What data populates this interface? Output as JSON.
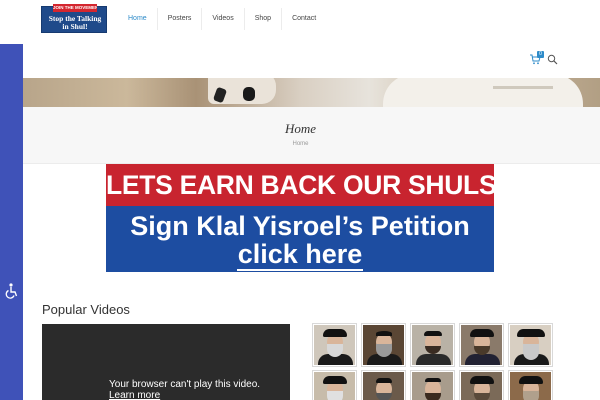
{
  "logo": {
    "banner": "JOIN THE MOVEMENT!",
    "line1": "Stop the Talking",
    "line2": "in Shul!"
  },
  "nav": {
    "items": [
      {
        "label": "Home",
        "active": true
      },
      {
        "label": "Posters",
        "active": false
      },
      {
        "label": "Videos",
        "active": false
      },
      {
        "label": "Shop",
        "active": false
      },
      {
        "label": "Contact",
        "active": false
      }
    ]
  },
  "cart": {
    "count": "0"
  },
  "colors": {
    "accent": "#2e8bc9",
    "a11y_bar": "#3f52b8",
    "petition_red": "#c8242f",
    "petition_blue": "#1d4da1"
  },
  "page_title": {
    "title": "Home",
    "breadcrumb": "Home"
  },
  "petition": {
    "headline": "LETS EARN BACK OUR SHULS!",
    "line1": "Sign Klal Yisroel’s Petition",
    "link": "click here"
  },
  "popular_videos": {
    "heading": "Popular Videos",
    "player_message": "Your browser can't play this video.",
    "player_link": "Learn more"
  },
  "icons": {
    "cart": "cart-icon",
    "search": "search-icon",
    "accessibility": "wheelchair-icon"
  }
}
